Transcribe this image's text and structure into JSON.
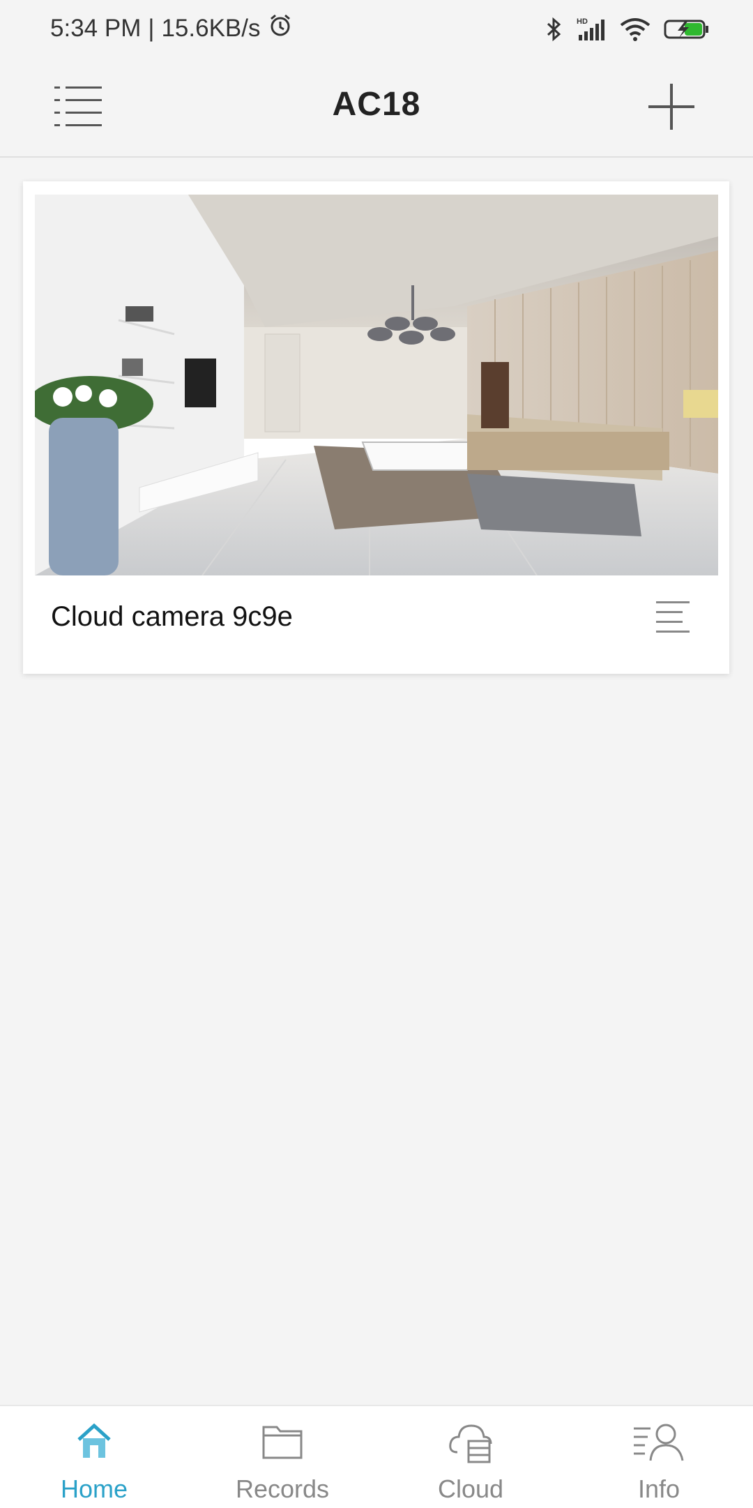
{
  "status_bar": {
    "time": "5:34 PM",
    "separator": "|",
    "speed": "15.6KB/s",
    "icons": [
      "alarm-icon",
      "bluetooth-icon",
      "hd-signal-icon",
      "wifi-icon",
      "battery-charging-icon"
    ]
  },
  "header": {
    "title": "AC18",
    "menu_icon": "list-menu-icon",
    "add_icon": "plus-icon"
  },
  "devices": [
    {
      "name": "Cloud camera 9c9e",
      "thumbnail": "living-room-preview",
      "menu_icon": "more-menu-icon"
    }
  ],
  "bottom_nav": {
    "active_color": "#2aa1c8",
    "inactive_color": "#888888",
    "items": [
      {
        "label": "Home",
        "icon": "home-icon",
        "active": true
      },
      {
        "label": "Records",
        "icon": "folder-icon",
        "active": false
      },
      {
        "label": "Cloud",
        "icon": "cloud-storage-icon",
        "active": false
      },
      {
        "label": "Info",
        "icon": "user-info-icon",
        "active": false
      }
    ]
  }
}
